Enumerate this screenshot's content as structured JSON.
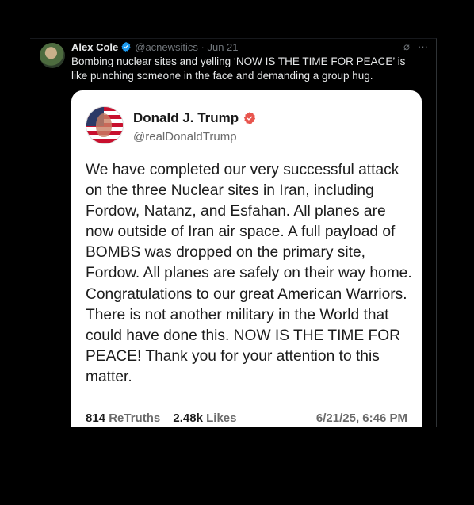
{
  "post": {
    "author_name": "Alex Cole",
    "author_handle": "@acnewsitics · Jun 21",
    "text": "Bombing nuclear sites and yelling ‘NOW IS THE TIME FOR PEACE’ is like punching someone in the face and demanding a group hug."
  },
  "quoted": {
    "author_name": "Donald J. Trump",
    "author_handle": "@realDonaldTrump",
    "body": "We have completed our very successful attack on the three Nuclear sites in Iran, including Fordow, Natanz, and Esfahan. All planes are now outside of Iran air space. A full payload of BOMBS was dropped on the primary site, Fordow. All planes are safely on their way home. Congratulations to our great American Warriors. There is not another military in the World that could have done this. NOW IS THE TIME FOR PEACE! Thank you for your attention to this matter.",
    "retruths_count": "814",
    "retruths_label": "ReTruths",
    "likes_count": "2.48k",
    "likes_label": "Likes",
    "date": "6/21/25, 6:46 PM"
  },
  "icons": {
    "verified_color": "#1d9bf0",
    "truth_verified_color": "#e8554e",
    "grok": "⌀",
    "more": "···"
  }
}
